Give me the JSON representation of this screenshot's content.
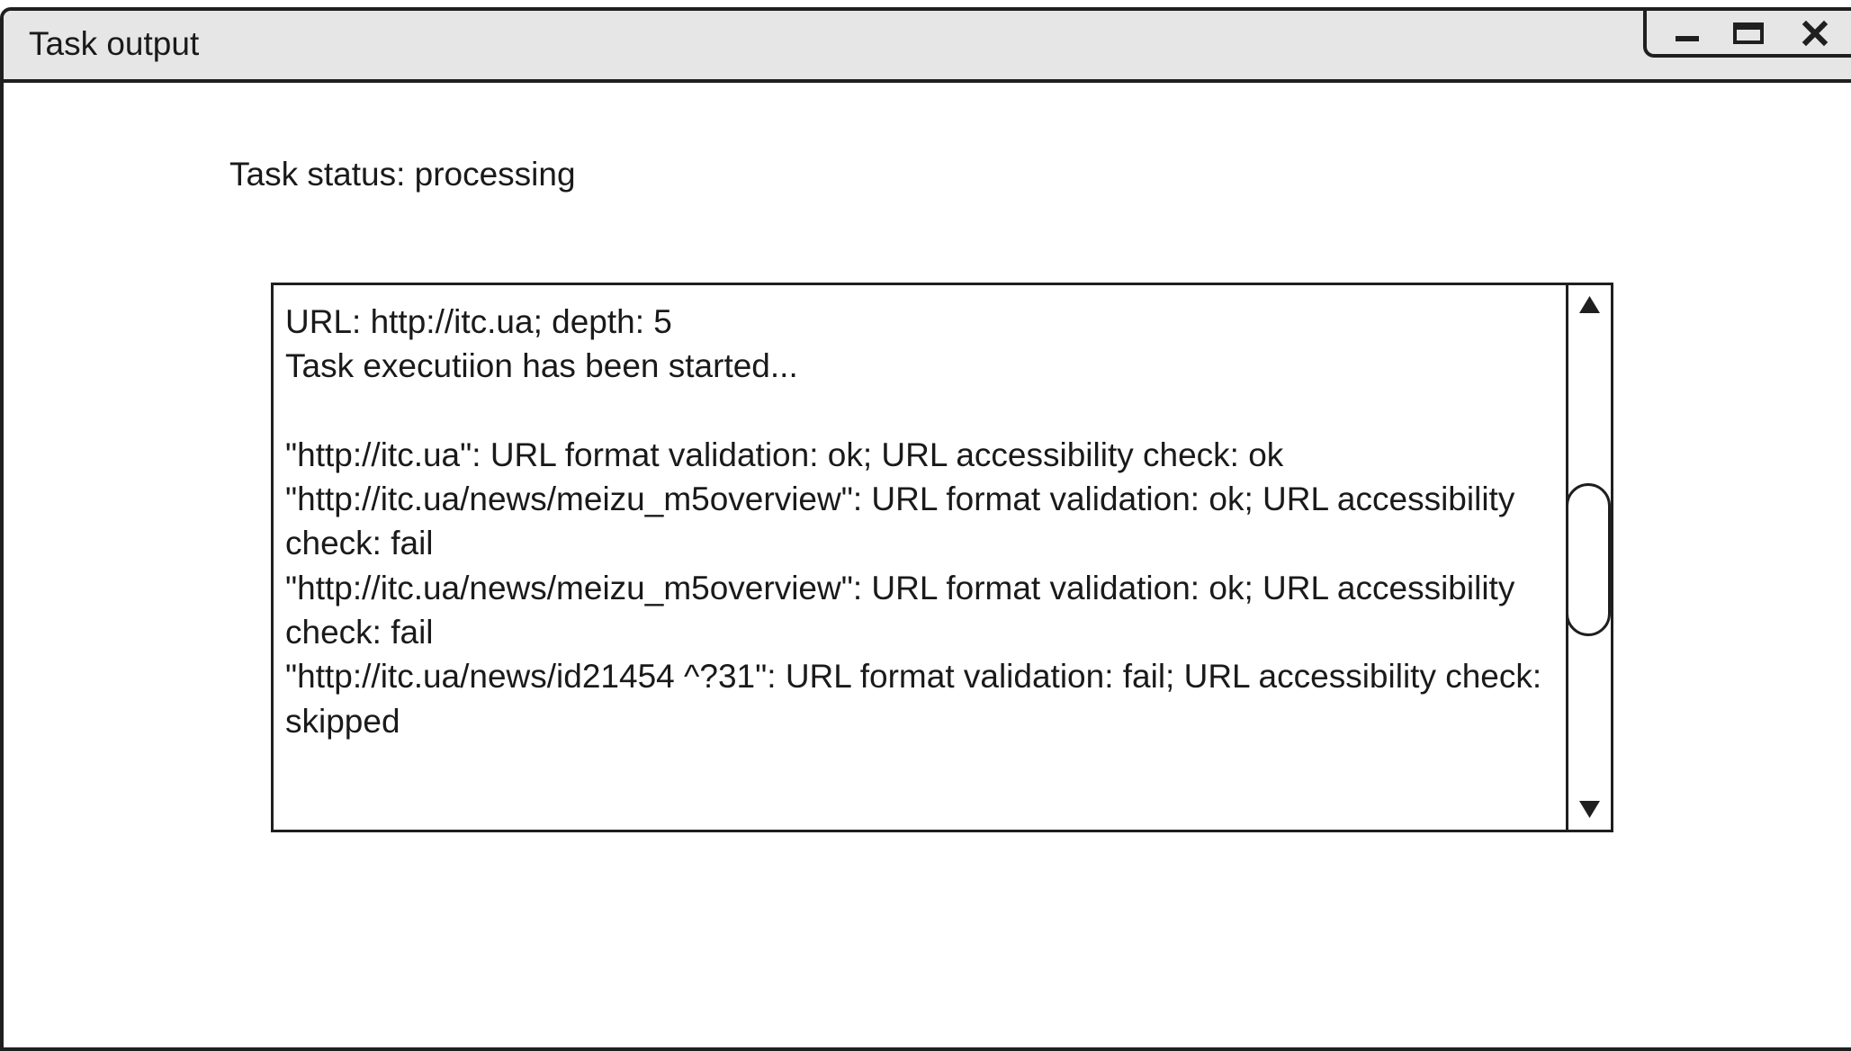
{
  "window": {
    "title": "Task output",
    "controls": {
      "minimize_icon": "minimize-icon",
      "maximize_icon": "maximize-icon",
      "close_icon": "close-icon"
    }
  },
  "main": {
    "status_text": "Task status: processing",
    "log": {
      "lines": [
        "URL: http://itc.ua; depth: 5",
        "Task executiion has been started...",
        "",
        "\"http://itc.ua\": URL format validation: ok; URL accessibility check: ok",
        "\"http://itc.ua/news/meizu_m5overview\": URL format validation: ok; URL accessibility check: fail",
        "\"http://itc.ua/news/meizu_m5overview\": URL format validation: ok; URL accessibility check: fail",
        "\"http://itc.ua/news/id21454 ^?31\": URL format validation: fail; URL accessibility check: skipped"
      ]
    },
    "scrollbar": {
      "up_icon": "arrow-up-icon",
      "down_icon": "arrow-down-icon"
    }
  },
  "colors": {
    "titlebar_bg": "#e6e6e6",
    "border": "#1f1f1f",
    "text": "#1a1a1a",
    "background": "#ffffff"
  }
}
